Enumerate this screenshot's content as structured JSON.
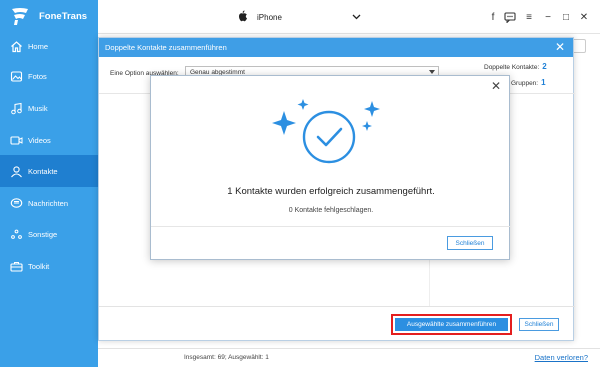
{
  "app": {
    "name": "FoneTrans",
    "brand_color": "#3aa0e8",
    "active_color": "#1f7fd0",
    "accent_color": "#2c8fe1"
  },
  "topbar": {
    "device_name": "iPhone",
    "icons": [
      "apple-icon",
      "chevron-down-icon",
      "facebook-icon",
      "chat-icon",
      "menu-icon",
      "minimize-icon",
      "maximize-icon",
      "close-icon"
    ],
    "facebook_glyph": "f",
    "menu_glyph": "≡",
    "minimize_glyph": "−",
    "maximize_glyph": "□",
    "close_glyph": "✕"
  },
  "sidebar": {
    "items": [
      {
        "label": "Home",
        "icon": "home-icon",
        "active": false
      },
      {
        "label": "Fotos",
        "icon": "photo-icon",
        "active": false
      },
      {
        "label": "Musik",
        "icon": "music-icon",
        "active": false
      },
      {
        "label": "Videos",
        "icon": "video-icon",
        "active": false
      },
      {
        "label": "Kontakte",
        "icon": "contacts-icon",
        "active": true
      },
      {
        "label": "Nachrichten",
        "icon": "messages-icon",
        "active": false
      },
      {
        "label": "Sonstige",
        "icon": "other-icon",
        "active": false
      },
      {
        "label": "Toolkit",
        "icon": "toolkit-icon",
        "active": false
      }
    ]
  },
  "status": {
    "summary": "Insgesamt: 69; Ausgewählt: 1",
    "recover_link": "Daten verloren?"
  },
  "merge_dialog": {
    "title": "Doppelte Kontakte zusammenführen",
    "close_glyph": "✕",
    "option_label": "Eine Option auswählen:",
    "option_value": "Genau abgestimmt",
    "duplicate_contacts_label": "Doppelte Kontakte:",
    "duplicate_contacts_count": "2",
    "duplicate_groups_label": "Gruppen:",
    "duplicate_groups_count": "1",
    "merge_button": "Ausgewählte zusammenführen",
    "close_button": "Schließen"
  },
  "success_dialog": {
    "close_glyph": "✕",
    "message": "1 Kontakte wurden erfolgreich zusammengeführt.",
    "failed_message": "0 Kontakte fehlgeschlagen.",
    "close_button": "Schließen",
    "check_color": "#2c8fe1"
  }
}
